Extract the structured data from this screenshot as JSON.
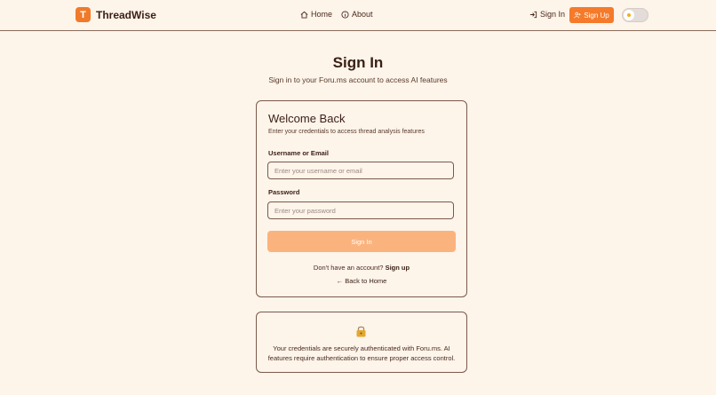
{
  "header": {
    "logo_letter": "T",
    "brand": "ThreadWise",
    "nav": [
      {
        "label": "Home",
        "icon": "home-icon"
      },
      {
        "label": "About",
        "icon": "info-icon"
      }
    ],
    "sign_in_label": "Sign In",
    "sign_up_label": "Sign Up",
    "theme_toggle_icon": "sun-icon"
  },
  "page": {
    "title": "Sign In",
    "subtitle": "Sign in to your Foru.ms account to access AI features"
  },
  "form": {
    "title": "Welcome Back",
    "description": "Enter your credentials to access thread analysis features",
    "username_label": "Username or Email",
    "username_placeholder": "Enter your username or email",
    "username_value": "",
    "password_label": "Password",
    "password_placeholder": "Enter your password",
    "password_value": "",
    "submit_label": "Sign In",
    "no_account_text": "Don't have an account?",
    "signup_link": "Sign up",
    "back_link": "← Back to Home"
  },
  "info": {
    "icon": "lock-icon",
    "text": "Your credentials are securely authenticated with Foru.ms. AI features require authentication to ensure proper access control."
  },
  "colors": {
    "accent": "#f57a2a",
    "background": "#fdf4ea",
    "submit_disabled": "#fbb37d"
  }
}
